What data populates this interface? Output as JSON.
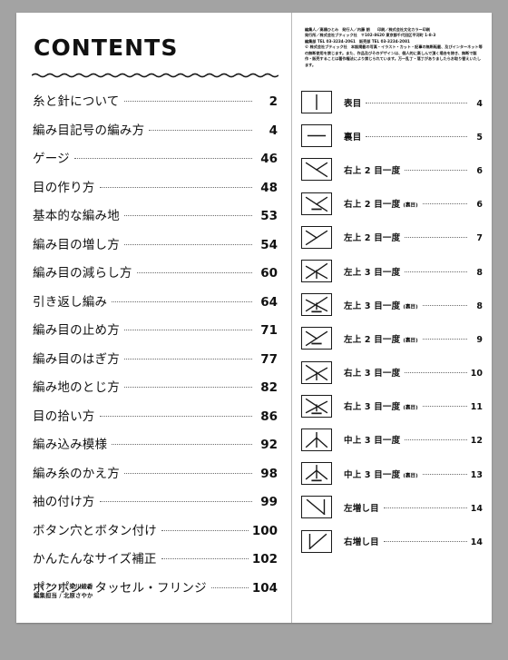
{
  "left_page": {
    "title": "CONTENTS",
    "divider": "wavy-rule",
    "entries": [
      {
        "label": "糸と針について",
        "page": "2"
      },
      {
        "label": "編み目記号の編み方",
        "page": "4"
      },
      {
        "label": "ゲージ",
        "page": "46"
      },
      {
        "label": "目の作り方",
        "page": "48"
      },
      {
        "label": "基本的な編み地",
        "page": "53"
      },
      {
        "label": "編み目の増し方",
        "page": "54"
      },
      {
        "label": "編み目の減らし方",
        "page": "60"
      },
      {
        "label": "引き返し編み",
        "page": "64"
      },
      {
        "label": "編み目の止め方",
        "page": "71"
      },
      {
        "label": "編み目のはぎ方",
        "page": "77"
      },
      {
        "label": "編み地のとじ方",
        "page": "82"
      },
      {
        "label": "目の拾い方",
        "page": "86"
      },
      {
        "label": "編み込み模様",
        "page": "92"
      },
      {
        "label": "編み糸のかえ方",
        "page": "98"
      },
      {
        "label": "袖の付け方",
        "page": "99"
      },
      {
        "label": "ボタン穴とボタン付け",
        "page": "100"
      },
      {
        "label": "かんたんなサイズ補正",
        "page": "102"
      },
      {
        "label": "ポンポン・タッセル・フリンジ",
        "page": "104"
      }
    ],
    "credits": [
      "レイアウト / 梁川綾香",
      "編集担当 / 北原さやか"
    ]
  },
  "right_page": {
    "colophon": [
      "編集人／高橋ひとみ　発行人／内藤 朗　　印刷／株式会社文化カラー印刷",
      "発行所／株式会社ブティック社　〒102-8620 東京都千代田区平河町 1-8-3",
      "編集部 TEL 03-3234-2061　販売部 TEL 03-3234-2081",
      "© 株式会社ブティック社　本誌掲載の写真・イラスト・カット・記事の無断転載、及びインターネット等の無断使用を禁じます。また、作品及びそのデザインは、個人的に楽しんで頂く場合を除き、無断で製作・販売することは著作権法により禁じられています。万一乱丁・落丁がありましたらお取り替えいたします。"
    ],
    "symbols": [
      {
        "glyph": "knit",
        "label": "表目",
        "sub": "",
        "page": "4"
      },
      {
        "glyph": "purl",
        "label": "裏目",
        "sub": "",
        "page": "5"
      },
      {
        "glyph": "right-2tog",
        "label": "右上 2 目一度",
        "sub": "",
        "page": "6"
      },
      {
        "glyph": "right-2tog-purl",
        "label": "右上 2 目一度",
        "sub": "(裏目)",
        "page": "6"
      },
      {
        "glyph": "left-2tog",
        "label": "左上 2 目一度",
        "sub": "",
        "page": "7"
      },
      {
        "glyph": "left-3tog",
        "label": "左上 3 目一度",
        "sub": "",
        "page": "8"
      },
      {
        "glyph": "left-3tog-purl",
        "label": "左上 3 目一度",
        "sub": "(裏目)",
        "page": "8"
      },
      {
        "glyph": "left-2tog-purl",
        "label": "左上 2 目一度",
        "sub": "(裏目)",
        "page": "9"
      },
      {
        "glyph": "right-3tog",
        "label": "右上 3 目一度",
        "sub": "",
        "page": "10"
      },
      {
        "glyph": "right-3tog-purl",
        "label": "右上 3 目一度",
        "sub": "(裏目)",
        "page": "11"
      },
      {
        "glyph": "center-3tog",
        "label": "中上 3 目一度",
        "sub": "",
        "page": "12"
      },
      {
        "glyph": "center-3tog-purl",
        "label": "中上 3 目一度",
        "sub": "(裏目)",
        "page": "13"
      },
      {
        "glyph": "left-inc",
        "label": "左増し目",
        "sub": "",
        "page": "14"
      },
      {
        "glyph": "right-inc",
        "label": "右増し目",
        "sub": "",
        "page": "14"
      }
    ]
  }
}
